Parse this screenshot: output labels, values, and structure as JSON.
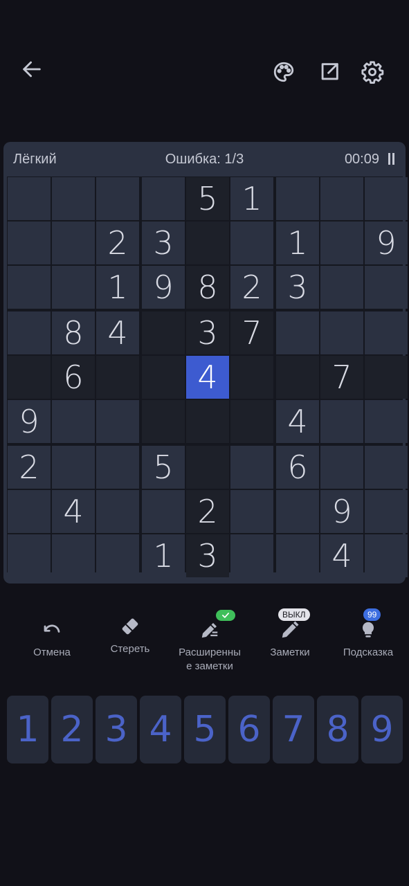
{
  "top_bar": {
    "icons": [
      "back-arrow-icon",
      "palette-icon",
      "share-icon",
      "gear-icon"
    ]
  },
  "board": {
    "difficulty": "Лёгкий",
    "mistakes_label": "Ошибка:",
    "mistakes_value": "1/3",
    "timer": "00:09",
    "selected_cell": {
      "row": 4,
      "col": 4
    },
    "grid": [
      [
        "",
        "",
        "",
        "",
        "5",
        "1",
        "",
        "",
        ""
      ],
      [
        "",
        "",
        "2",
        "3",
        "",
        "",
        "1",
        "",
        "9"
      ],
      [
        "",
        "",
        "1",
        "9",
        "8",
        "2",
        "3",
        "",
        ""
      ],
      [
        "",
        "8",
        "4",
        "",
        "3",
        "7",
        "",
        "",
        ""
      ],
      [
        "",
        "6",
        "",
        "",
        "4",
        "",
        "",
        "7",
        ""
      ],
      [
        "9",
        "",
        "",
        "",
        "",
        "",
        "4",
        "",
        ""
      ],
      [
        "2",
        "",
        "",
        "5",
        "",
        "",
        "6",
        "",
        ""
      ],
      [
        "",
        "4",
        "",
        "",
        "2",
        "",
        "",
        "9",
        ""
      ],
      [
        "",
        "",
        "",
        "1",
        "3",
        "",
        "",
        "4",
        ""
      ]
    ],
    "highlight": [
      [
        0,
        0,
        0,
        0,
        1,
        0,
        0,
        0,
        0
      ],
      [
        0,
        0,
        0,
        0,
        1,
        0,
        0,
        0,
        0
      ],
      [
        0,
        0,
        0,
        0,
        1,
        0,
        0,
        0,
        0
      ],
      [
        0,
        0,
        0,
        1,
        1,
        1,
        0,
        0,
        0
      ],
      [
        1,
        1,
        1,
        1,
        2,
        1,
        1,
        1,
        1
      ],
      [
        0,
        0,
        0,
        1,
        1,
        1,
        0,
        0,
        0
      ],
      [
        0,
        0,
        0,
        0,
        1,
        0,
        0,
        0,
        0
      ],
      [
        0,
        0,
        0,
        0,
        1,
        0,
        0,
        0,
        0
      ],
      [
        0,
        0,
        0,
        0,
        1,
        0,
        0,
        0,
        0
      ]
    ]
  },
  "tools": {
    "undo": {
      "label": "Отмена"
    },
    "erase": {
      "label": "Стереть"
    },
    "advanced_notes": {
      "label": "Расширенны\nе заметки",
      "badge": "check"
    },
    "notes": {
      "label": "Заметки",
      "badge": "ВЫКЛ"
    },
    "hint": {
      "label": "Подсказка",
      "badge": "99"
    }
  },
  "numpad": [
    "1",
    "2",
    "3",
    "4",
    "5",
    "6",
    "7",
    "8",
    "9"
  ],
  "colors": {
    "background": "#111118",
    "cell": "#2b3141",
    "cell_highlight": "#1d2029",
    "selected": "#3d5bd0",
    "numpad_digit": "#4b63c8"
  }
}
